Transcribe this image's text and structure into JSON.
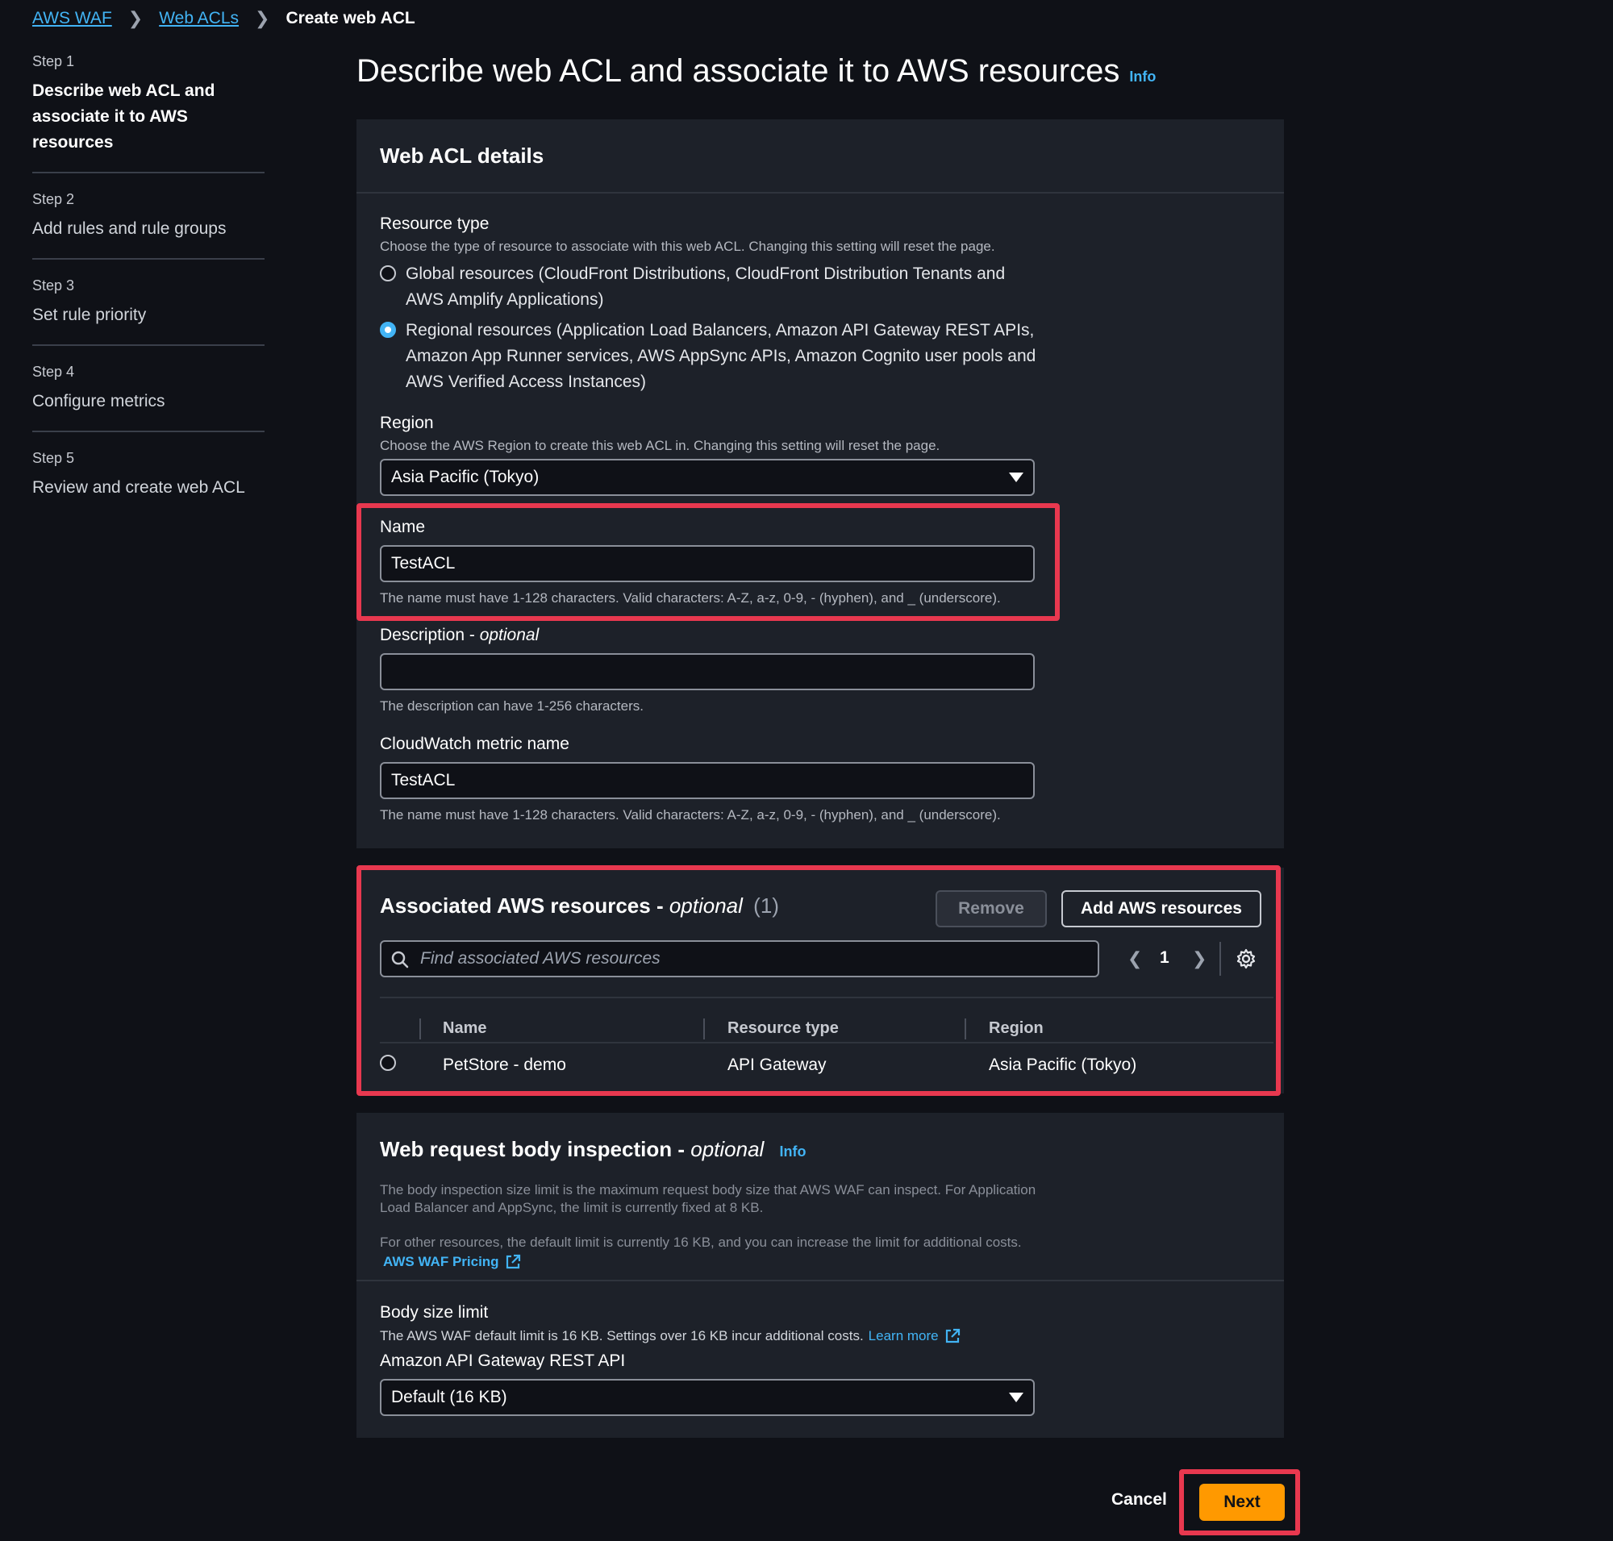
{
  "breadcrumb": {
    "item1": "AWS WAF",
    "item2": "Web ACLs",
    "current": "Create web ACL"
  },
  "steps": [
    {
      "num": "Step 1",
      "title": "Describe web ACL and associate it to AWS resources"
    },
    {
      "num": "Step 2",
      "title": "Add rules and rule groups"
    },
    {
      "num": "Step 3",
      "title": "Set rule priority"
    },
    {
      "num": "Step 4",
      "title": "Configure metrics"
    },
    {
      "num": "Step 5",
      "title": "Review and create web ACL"
    }
  ],
  "page": {
    "title": "Describe web ACL and associate it to AWS resources",
    "info": "Info"
  },
  "details": {
    "title": "Web ACL details",
    "resource_type_label": "Resource type",
    "resource_type_desc": "Choose the type of resource to associate with this web ACL. Changing this setting will reset the page.",
    "option_global": "Global resources (CloudFront Distributions, CloudFront Distribution Tenants and AWS Amplify Applications)",
    "option_regional": "Regional resources (Application Load Balancers, Amazon API Gateway REST APIs, Amazon App Runner services, AWS AppSync APIs, Amazon Cognito user pools and AWS Verified Access Instances)",
    "region_label": "Region",
    "region_desc": "Choose the AWS Region to create this web ACL in. Changing this setting will reset the page.",
    "region_value": "Asia Pacific (Tokyo)",
    "name_label": "Name",
    "name_value": "TestACL",
    "name_hint": "The name must have 1-128 characters. Valid characters: A-Z, a-z, 0-9, - (hyphen), and _ (underscore).",
    "description_label": "Description - ",
    "description_optional": "optional",
    "description_value": "",
    "description_hint": "The description can have 1-256 characters.",
    "metric_label": "CloudWatch metric name",
    "metric_value": "TestACL",
    "metric_hint": "The name must have 1-128 characters. Valid characters: A-Z, a-z, 0-9, - (hyphen), and _ (underscore)."
  },
  "resources": {
    "title": "Associated AWS resources - ",
    "optional": "optional",
    "count": "(1)",
    "remove_label": "Remove",
    "add_label": "Add AWS resources",
    "search_placeholder": "Find associated AWS resources",
    "page_number": "1",
    "columns": {
      "name": "Name",
      "type": "Resource type",
      "region": "Region"
    },
    "rows": [
      {
        "name": "PetStore - demo",
        "type": "API Gateway",
        "region": "Asia Pacific (Tokyo)"
      }
    ]
  },
  "body": {
    "title": "Web request body inspection - ",
    "optional": "optional",
    "info": "Info",
    "desc1": "The body inspection size limit is the maximum request body size that AWS WAF can inspect. For Application Load Balancer and AppSync, the limit is currently fixed at 8 KB.",
    "desc2": "For other resources, the default limit is currently 16 KB, and you can increase the limit for additional costs.",
    "pricing_link": "AWS WAF Pricing",
    "size_label": "Body size limit",
    "size_desc": "The AWS WAF default limit is 16 KB. Settings over 16 KB incur additional costs.",
    "learn_more": "Learn more",
    "api_label": "Amazon API Gateway REST API",
    "api_value": "Default (16 KB)"
  },
  "footer": {
    "cancel": "Cancel",
    "next": "Next"
  },
  "colors": {
    "accent": "#42b4f5",
    "primary": "#ff9900",
    "highlight": "#e8384f"
  }
}
